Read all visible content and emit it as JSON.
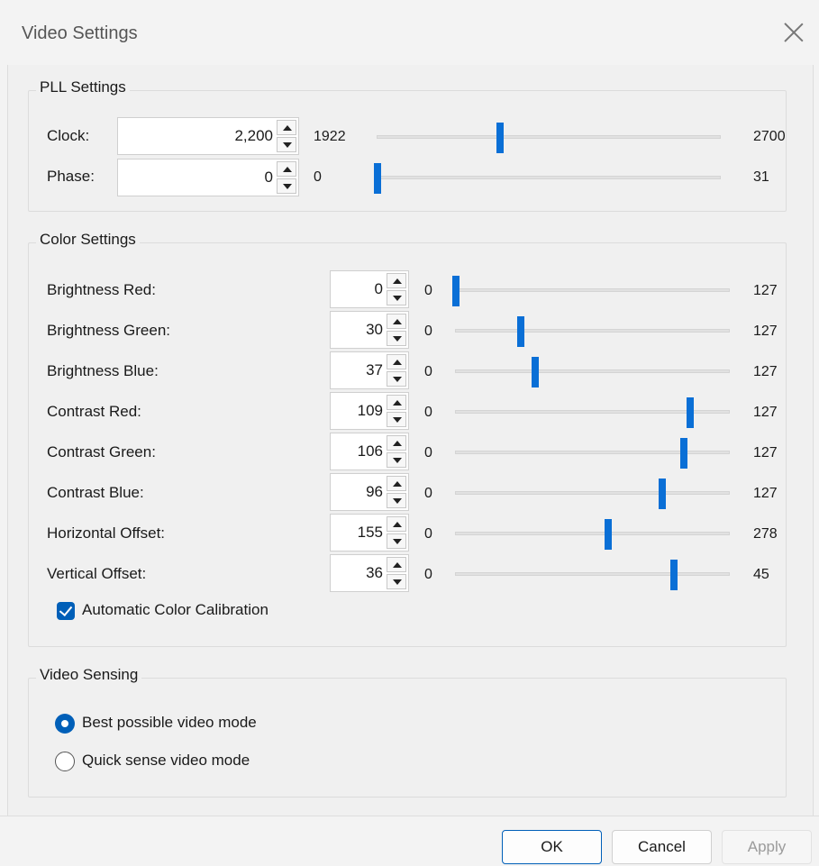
{
  "window": {
    "title": "Video Settings"
  },
  "pll": {
    "legend": "PLL Settings",
    "rows": [
      {
        "label": "Clock:",
        "value": "2,200",
        "min": "1922",
        "max": "2700",
        "fraction": 0.357
      },
      {
        "label": "Phase:",
        "value": "0",
        "min": "0",
        "max": "31",
        "fraction": 0.0
      }
    ]
  },
  "color": {
    "legend": "Color Settings",
    "rows": [
      {
        "label": "Brightness Red:",
        "value": "0",
        "min": "0",
        "max": "127",
        "fraction": 0.0
      },
      {
        "label": "Brightness Green:",
        "value": "30",
        "min": "0",
        "max": "127",
        "fraction": 0.236
      },
      {
        "label": "Brightness Blue:",
        "value": "37",
        "min": "0",
        "max": "127",
        "fraction": 0.291
      },
      {
        "label": "Contrast Red:",
        "value": "109",
        "min": "0",
        "max": "127",
        "fraction": 0.858
      },
      {
        "label": "Contrast Green:",
        "value": "106",
        "min": "0",
        "max": "127",
        "fraction": 0.835
      },
      {
        "label": "Contrast Blue:",
        "value": "96",
        "min": "0",
        "max": "127",
        "fraction": 0.756
      },
      {
        "label": "Horizontal Offset:",
        "value": "155",
        "min": "0",
        "max": "278",
        "fraction": 0.558
      },
      {
        "label": "Vertical Offset:",
        "value": "36",
        "min": "0",
        "max": "45",
        "fraction": 0.8
      }
    ],
    "auto_calibration": {
      "label": "Automatic Color Calibration",
      "checked": true
    }
  },
  "sensing": {
    "legend": "Video Sensing",
    "options": [
      {
        "label": "Best possible video mode",
        "selected": true
      },
      {
        "label": "Quick sense video mode",
        "selected": false
      }
    ]
  },
  "buttons": {
    "ok": "OK",
    "cancel": "Cancel",
    "apply": "Apply"
  },
  "colors": {
    "accent": "#0a6fd6",
    "checkbox": "#005fb8"
  }
}
